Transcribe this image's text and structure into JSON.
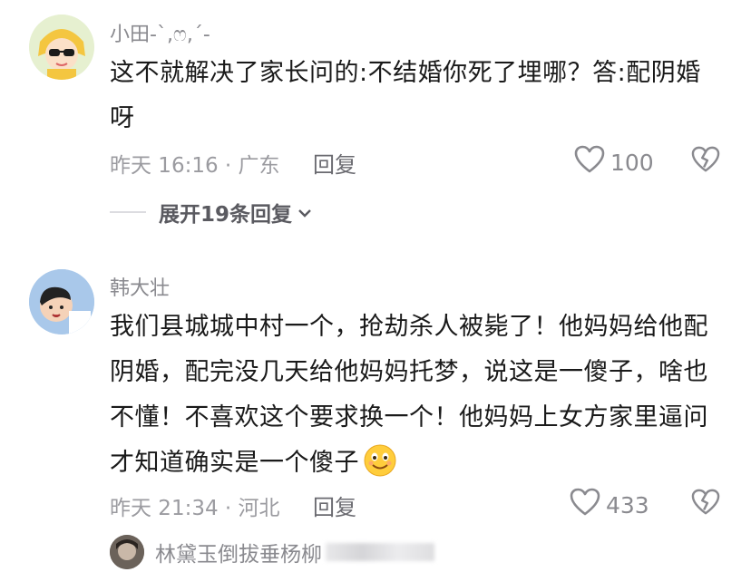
{
  "comments": [
    {
      "username": "小田-ˋ,ෆ,ˊ-",
      "text": "这不就解决了家长问的:不结婚你死了埋哪？答:配阴婚呀",
      "time_location": "昨天 16:16 · 广东",
      "reply_label": "回复",
      "likes": "100",
      "expand_label": "展开19条回复"
    },
    {
      "username": "韩大壮",
      "text": "我们县城城中村一个，抢劫杀人被毙了！他妈妈给他配阴婚，配完没几天给他妈妈托梦，说这是一傻子，啥也不懂！不喜欢这个要求换一个！他妈妈上女方家里逼问才知道确实是一个傻子",
      "time_location": "昨天 21:34 · 河北",
      "reply_label": "回复",
      "likes": "433"
    }
  ],
  "sub_reply": {
    "username": "林黛玉倒拔垂杨柳"
  },
  "colors": {
    "text": "#1a1a1a",
    "meta": "#9b9ba0",
    "icon": "#8a8a8f"
  },
  "icons": [
    "heart-icon",
    "broken-heart-icon",
    "chevron-down-icon",
    "smile-emoji-icon"
  ]
}
